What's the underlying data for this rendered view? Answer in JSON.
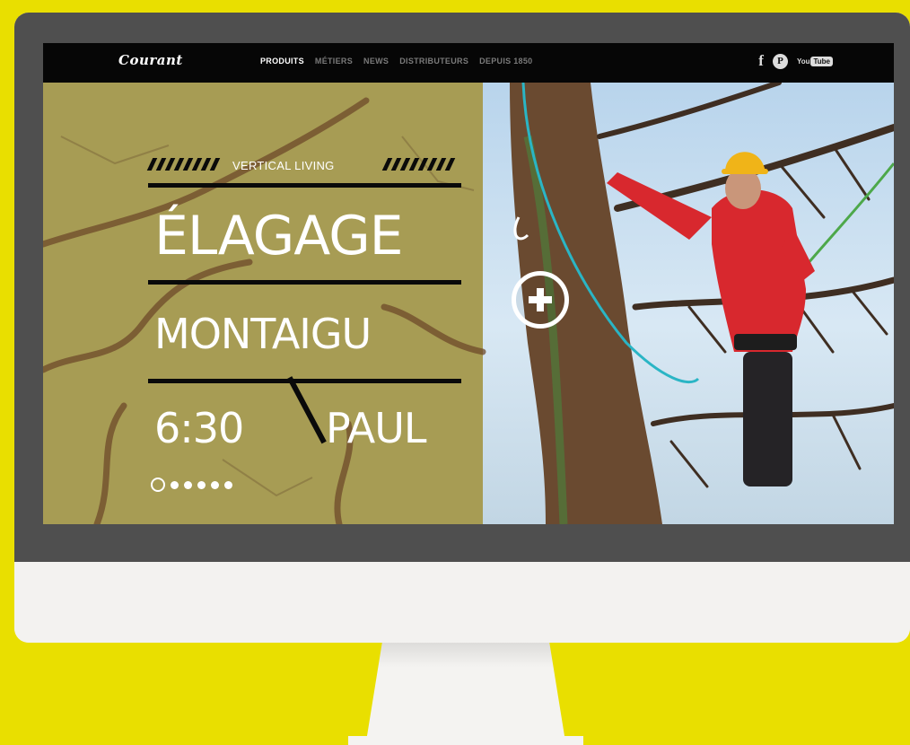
{
  "brand": {
    "logo_text": "Courant"
  },
  "nav": {
    "items": [
      {
        "label": "PRODUITS",
        "active": true
      },
      {
        "label": "MÉTIERS",
        "active": false
      },
      {
        "label": "NEWS",
        "active": false
      },
      {
        "label": "DISTRIBUTEURS",
        "active": false
      },
      {
        "label": "DEPUIS 1850",
        "active": false
      }
    ]
  },
  "social": {
    "facebook_glyph": "f",
    "pinterest_glyph": "P",
    "youtube_you": "You",
    "youtube_tube": "Tube"
  },
  "hero": {
    "tagline": "VERTICAL LIVING",
    "title": "ÉLAGAGE",
    "location": "MONTAIGU",
    "time": "6:30",
    "person": "PAUL",
    "slides_total": 6,
    "slide_active": 1
  },
  "colors": {
    "page_background": "#e9df00",
    "bezel": "#4f4f4f",
    "hero_panel": "#a79c54",
    "jacket_red": "#d8282e",
    "helmet_yellow": "#f0b418",
    "rope_cyan": "#2ab5c5"
  },
  "icons": [
    "facebook-icon",
    "pinterest-icon",
    "youtube-icon",
    "plus-circle-icon"
  ]
}
